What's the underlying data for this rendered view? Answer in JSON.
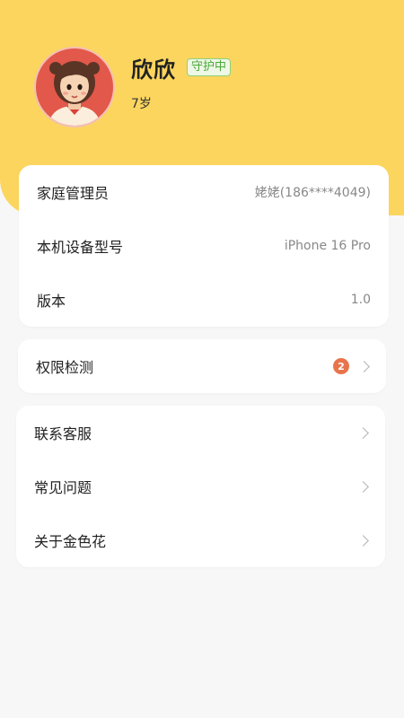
{
  "profile": {
    "name": "欣欣",
    "status_badge": "守护中",
    "age": "7岁"
  },
  "info_card": {
    "items": [
      {
        "label": "家庭管理员",
        "value": "姥姥(186****4049)"
      },
      {
        "label": "本机设备型号",
        "value": "iPhone 16 Pro"
      },
      {
        "label": "版本",
        "value": "1.0"
      }
    ]
  },
  "permission_card": {
    "label": "权限检测",
    "count": "2"
  },
  "menu": {
    "items": [
      {
        "label": "联系客服"
      },
      {
        "label": "常见问题"
      },
      {
        "label": "关于金色花"
      }
    ]
  },
  "colors": {
    "header_bg": "#fcd55e",
    "badge_green": "#4aa83a",
    "count_orange": "#e8744c",
    "avatar_bg": "#e2584a"
  }
}
